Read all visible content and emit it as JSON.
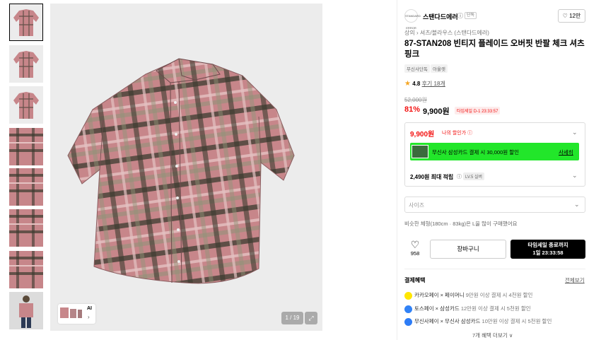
{
  "gallery": {
    "thumbnails": [
      "front",
      "front",
      "front",
      "detail",
      "detail",
      "detail",
      "detail",
      "model"
    ],
    "counter": "1 / 19",
    "ai_label": "AI",
    "shirt_colors": {
      "base": "#c7868a",
      "dark": "#3a3a2e",
      "light": "#e5c2c2",
      "green": "#8e9478"
    }
  },
  "brand": {
    "logo_text": "STANDARD ERROR",
    "name": "스탠다드에러",
    "tag": "단독",
    "likes": "12만"
  },
  "product": {
    "breadcrumb": "상의 › 셔츠/블라우스 (스탠다드에러)",
    "title": "87-STAN208 빈티지 플레이드 오버핏 반팔 체크 셔츠 핑크",
    "tags": [
      "무신사단독",
      "아울렛"
    ],
    "rating": "4.8",
    "reviews": "후기 18개",
    "original_price": "52,000원",
    "discount": "81%",
    "price": "9,900원",
    "timer_badge": "타임세일 D-1 23:33:57"
  },
  "benefit": {
    "my_price": "9,900원",
    "my_price_label": "나의 할인가 ⓘ",
    "card_text": "무신사 삼성카드 결제 시 30,000원 할인",
    "card_link": "사세히",
    "points": "2,490원 최대 적립",
    "points_info": "ⓘ",
    "level": "LV.5 실버"
  },
  "options": {
    "size_placeholder": "사이즈",
    "similar_text": "비슷한 체형(180cm · 83kg)은 L을 많이 구매했어요"
  },
  "actions": {
    "like_count": "958",
    "cart": "장바구니",
    "buy_line1": "타임세일 종료까지",
    "buy_line2": "1일 23:33:58"
  },
  "payment": {
    "title": "결제혜택",
    "detail": "전체보기",
    "rows": [
      {
        "main": "카카오페이 × 페이머니",
        "sub": " 9만원 이상 결제 시 4천원 할인",
        "color": "#ffe600"
      },
      {
        "main": "토스페이 × 삼성카드",
        "sub": " 12만원 이상 결제 시 5천원 할인",
        "color": "#3182f6"
      },
      {
        "main": "무신사페이 × 무신사 삼성카드",
        "sub": " 10만원 이상 결제 시 5천원 할인",
        "color": "#2d7cf6"
      }
    ],
    "more": "7개 혜택 더보기 ∨"
  }
}
